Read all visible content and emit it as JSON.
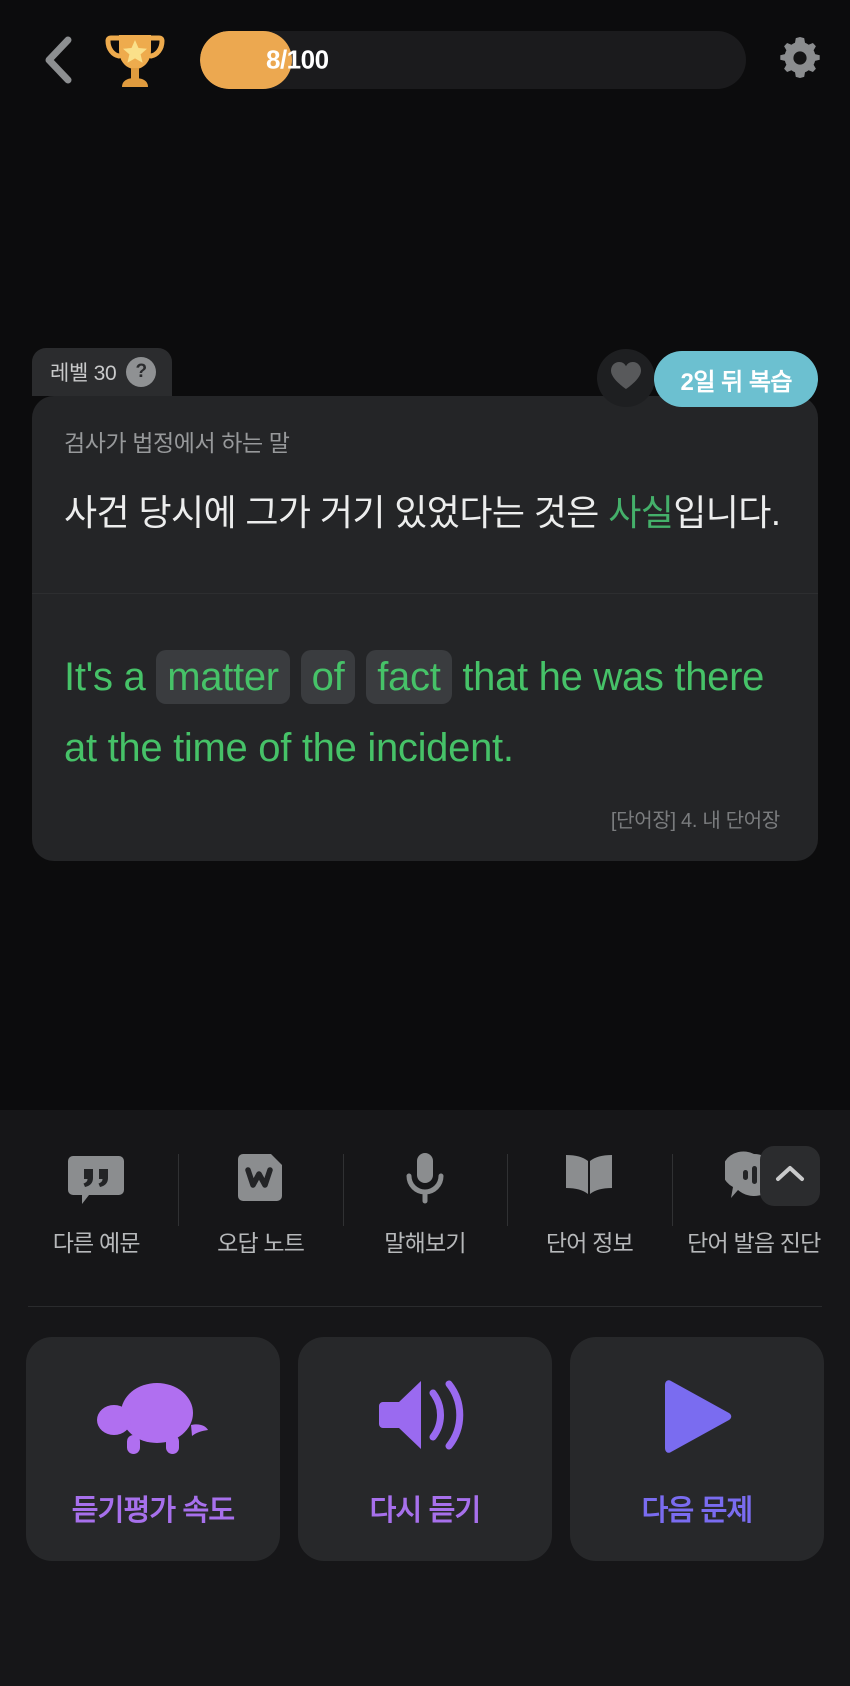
{
  "topbar": {
    "back_icon": "chevron-left-icon",
    "trophy_icon": "trophy-icon",
    "progress": {
      "current": 8,
      "total": 100,
      "text": "8/100",
      "fill_color": "#eca850",
      "track_color": "#1b1b1d"
    },
    "settings_icon": "gear-icon"
  },
  "card": {
    "level_badge": {
      "label": "레벨 30",
      "help_glyph": "?"
    },
    "favorite_icon": "heart-icon",
    "review_button": {
      "label": "2일 뒤 복습",
      "color": "#6cc0d0"
    },
    "context_label": "검사가 법정에서 하는 말",
    "korean": {
      "before": "사건 당시에 그가 거기 있었다는 것은 ",
      "highlight": "사실",
      "after": "입니다.",
      "highlight_color": "#44b06a"
    },
    "english": {
      "color": "#46c268",
      "parts": [
        {
          "text": "It's a ",
          "chip": false
        },
        {
          "text": "matter",
          "chip": true
        },
        {
          "text": " ",
          "chip": false
        },
        {
          "text": "of",
          "chip": true
        },
        {
          "text": " ",
          "chip": false
        },
        {
          "text": "fact",
          "chip": true
        },
        {
          "text": " that he was there at the time of the incident.",
          "chip": false
        }
      ],
      "plain": "It's a matter of fact that he was there at the time of the incident."
    },
    "source_label": "[단어장] 4. 내 단어장"
  },
  "scroll_up": {
    "icon": "chevron-up-icon"
  },
  "tools": [
    {
      "icon": "quote-bubble-icon",
      "label": "다른 예문"
    },
    {
      "icon": "wrong-answer-note-icon",
      "label": "오답 노트"
    },
    {
      "icon": "microphone-icon",
      "label": "말해보기"
    },
    {
      "icon": "open-book-icon",
      "label": "단어 정보"
    },
    {
      "icon": "pronunciation-bubble-icon",
      "label": "단어 발음 진단"
    }
  ],
  "actions": [
    {
      "icon": "turtle-icon",
      "label": "듣기평가 속도",
      "color": "#a770ec"
    },
    {
      "icon": "speaker-icon",
      "label": "다시 듣기",
      "color": "#a770ec"
    },
    {
      "icon": "play-icon",
      "label": "다음 문제",
      "color": "#7a6cf0"
    }
  ]
}
